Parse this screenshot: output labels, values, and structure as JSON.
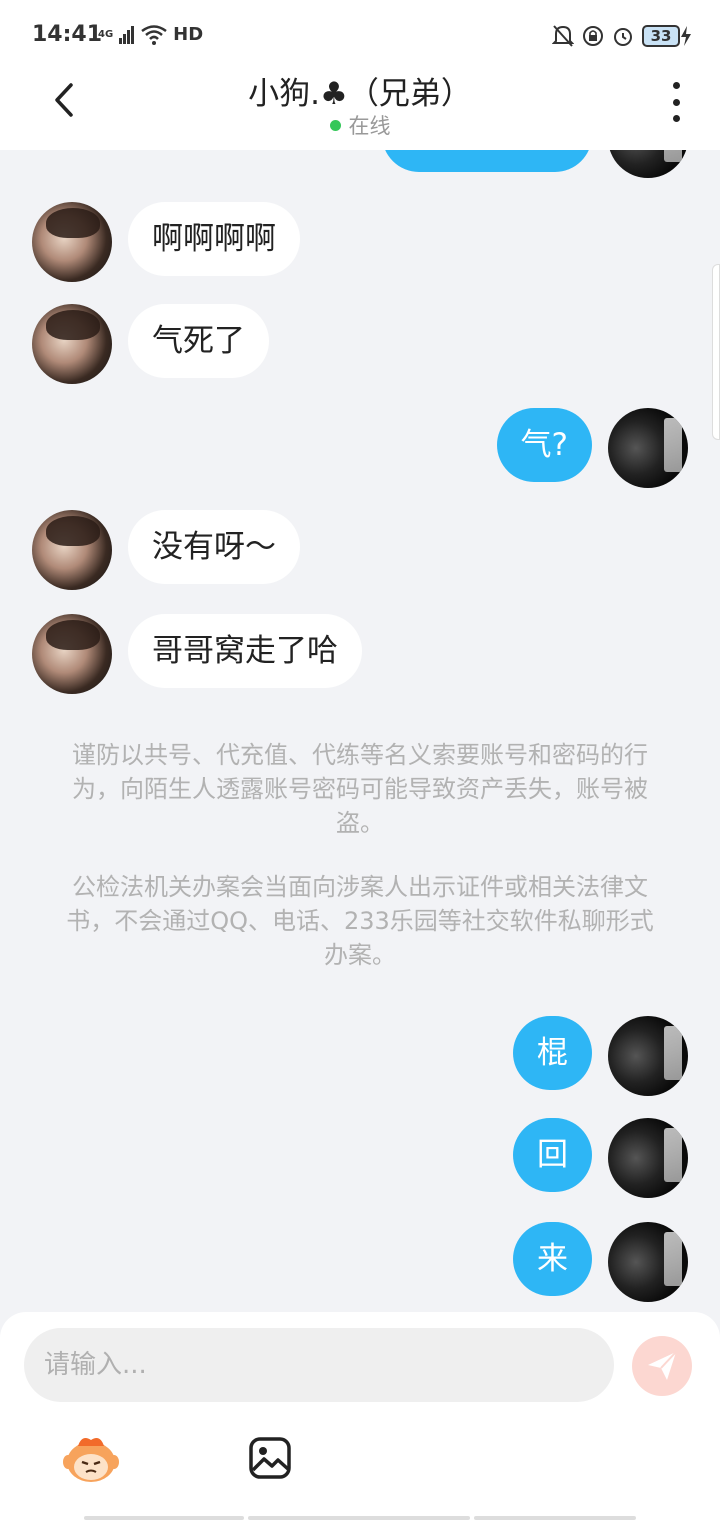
{
  "status_bar": {
    "time": "14:41",
    "network": "4G",
    "hd": "HD",
    "battery": "33"
  },
  "header": {
    "title": "小狗.♣（兄弟）",
    "status": "在线"
  },
  "messages": [
    {
      "sender": "friend",
      "text": "啊啊啊啊"
    },
    {
      "sender": "friend",
      "text": "气死了"
    },
    {
      "sender": "me",
      "text": "气?"
    },
    {
      "sender": "friend",
      "text": "没有呀～"
    },
    {
      "sender": "friend",
      "text": "哥哥窝走了哈"
    },
    {
      "sender": "me",
      "text": "棍"
    },
    {
      "sender": "me",
      "text": "回"
    },
    {
      "sender": "me",
      "text": "来"
    }
  ],
  "notices": {
    "line1": "谨防以共号、代充值、代练等名义索要账号和密码的行为，向陌生人透露账号密码可能导致资产丢失，账号被盗。",
    "line2": "公检法机关办案会当面向涉案人出示证件或相关法律文书，不会通过QQ、电话、233乐园等社交软件私聊形式办案。"
  },
  "input": {
    "placeholder": "请输入...",
    "value": ""
  },
  "colors": {
    "accent": "#2eb6f5",
    "online": "#34c759",
    "send_disabled": "#fcd7d1"
  },
  "icons": [
    "back-icon",
    "more-icon",
    "send-icon",
    "emoji-icon",
    "image-icon"
  ]
}
